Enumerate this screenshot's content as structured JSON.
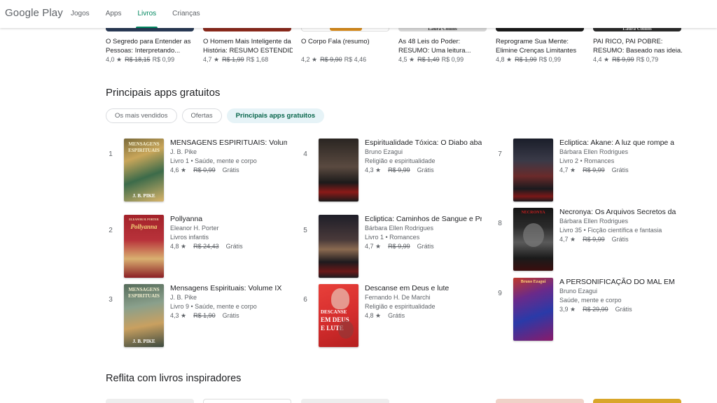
{
  "header": {
    "logo": "Google Play",
    "nav": [
      {
        "label": "Jogos"
      },
      {
        "label": "Apps"
      },
      {
        "label": "Livros",
        "active": true
      },
      {
        "label": "Crianças"
      }
    ]
  },
  "top_strip": [
    {
      "title1": "O Segredo para Entender as",
      "title2": "Pessoas: Interpretando...",
      "rating": "4,0 ★",
      "old_price": "R$ 18,15",
      "new_price": "R$ 0,99",
      "cover_color": "#2a3a55",
      "cover_text": ""
    },
    {
      "title1": "O Homem Mais Inteligente da",
      "title2": "História: RESUMO ESTENDID...",
      "rating": "4,7 ★",
      "old_price": "R$ 1,99",
      "new_price": "R$ 1,68",
      "cover_color": "#8a2a1c",
      "cover_text": ""
    },
    {
      "title1": "O Corpo Fala (resumo)",
      "title2": "",
      "rating": "4,2 ★",
      "old_price": "R$ 9,90",
      "new_price": "R$ 4,46",
      "cover_color": "#d98b1a",
      "cover_text": ""
    },
    {
      "title1": "As 48 Leis do Poder:",
      "title2": "RESUMO: Uma leitura...",
      "rating": "4,5 ★",
      "old_price": "R$ 1,49",
      "new_price": "R$ 0,99",
      "cover_color": "#d6d6d6",
      "cover_text": "Laura Collins"
    },
    {
      "title1": "Reprograme Sua Mente:",
      "title2": "Elimine Crenças Limitantes",
      "rating": "4,8 ★",
      "old_price": "R$ 1,99",
      "new_price": "R$ 0,99",
      "cover_color": "#1b1b1b",
      "cover_text": ""
    },
    {
      "title1": "PAI RICO, PAI POBRE:",
      "title2": "RESUMO: Baseado nas ideia...",
      "rating": "4,4 ★",
      "old_price": "R$ 9,99",
      "new_price": "R$ 0,79",
      "cover_color": "#2b2b2b",
      "cover_text": "Laura Collins"
    }
  ],
  "section": {
    "title": "Principais apps gratuitos",
    "chips": [
      {
        "label": "Os mais vendidos",
        "selected": false
      },
      {
        "label": "Ofertas",
        "selected": false
      },
      {
        "label": "Principais apps gratuitos",
        "selected": true
      }
    ]
  },
  "ranked": [
    {
      "rank": "1",
      "title": "MENSAGENS ESPIRITUAIS: Volume I",
      "author": "J. B. Pike",
      "series": "Livro 1",
      "category": "Saúde, mente e corpo",
      "rating": "4,6 ★",
      "old_price": "R$ 0,99",
      "price": "Grátis",
      "cover_lines": [
        "MENSAGENS",
        "ESPIRITUAIS",
        "J. B. PIKE"
      ]
    },
    {
      "rank": "2",
      "title": "Pollyanna",
      "author": "Eleanor H. Porter",
      "series": "",
      "category": "Livros infantis",
      "rating": "4,8 ★",
      "old_price": "R$ 24,43",
      "price": "Grátis",
      "cover_lines": [
        "ELEANOR H. PORTER",
        "Pollyanna"
      ]
    },
    {
      "rank": "3",
      "title": "Mensagens Espirituais: Volume IX",
      "author": "J. B. Pike",
      "series": "Livro 9",
      "category": "Saúde, mente e corpo",
      "rating": "4,3 ★",
      "old_price": "R$ 1,90",
      "price": "Grátis",
      "cover_lines": [
        "MENSAGENS",
        "ESPIRITUAIS",
        "J. B. PIKE"
      ]
    },
    {
      "rank": "4",
      "title": "Espiritualidade Tóxica: O Diabo abandonou",
      "author": "Bruno Ezagui",
      "series": "",
      "category": "Religião e espiritualidade",
      "rating": "4,3 ★",
      "old_price": "R$ 9,99",
      "price": "Grátis",
      "cover_lines": []
    },
    {
      "rank": "5",
      "title": "Ecliptica: Caminhos de Sangue e Prata",
      "author": "Bárbara Ellen Rodrigues",
      "series": "Livro 1",
      "category": "Romances",
      "rating": "4,7 ★",
      "old_price": "R$ 9,99",
      "price": "Grátis",
      "cover_lines": []
    },
    {
      "rank": "6",
      "title": "Descanse em Deus e lute",
      "author": "Fernando H. De Marchi",
      "series": "",
      "category": "Religião e espiritualidade",
      "rating": "4,8 ★",
      "old_price": "",
      "price": "Grátis",
      "cover_lines": [
        "DESCANSE",
        "EM DEUS",
        "E LUTE"
      ]
    },
    {
      "rank": "7",
      "title": "Ecliptica: Akane: A luz que rompe a escuridão",
      "author": "Bárbara Ellen Rodrigues",
      "series": "Livro 2",
      "category": "Romances",
      "rating": "4,7 ★",
      "old_price": "R$ 9,99",
      "price": "Grátis",
      "cover_lines": []
    },
    {
      "rank": "8",
      "title": "Necronya: Os Arquivos Secretos da Criatura",
      "author": "Bárbara Ellen Rodrigues",
      "series": "Livro 35",
      "category": "Ficção científica e fantasia",
      "rating": "4,7 ★",
      "old_price": "R$ 9,99",
      "price": "Grátis",
      "cover_lines": [
        "NECRONYA"
      ]
    },
    {
      "rank": "9",
      "title": "A PERSONIFICAÇÃO DO MAL EM NÓS",
      "author": "Bruno Ezagui",
      "series": "",
      "category": "Saúde, mente e corpo",
      "rating": "3,9 ★",
      "old_price": "R$ 29,99",
      "price": "Grátis",
      "cover_lines": [
        "Bruno Ezagui"
      ]
    }
  ],
  "section2": {
    "title": "Reflita com livros inspiradores"
  }
}
